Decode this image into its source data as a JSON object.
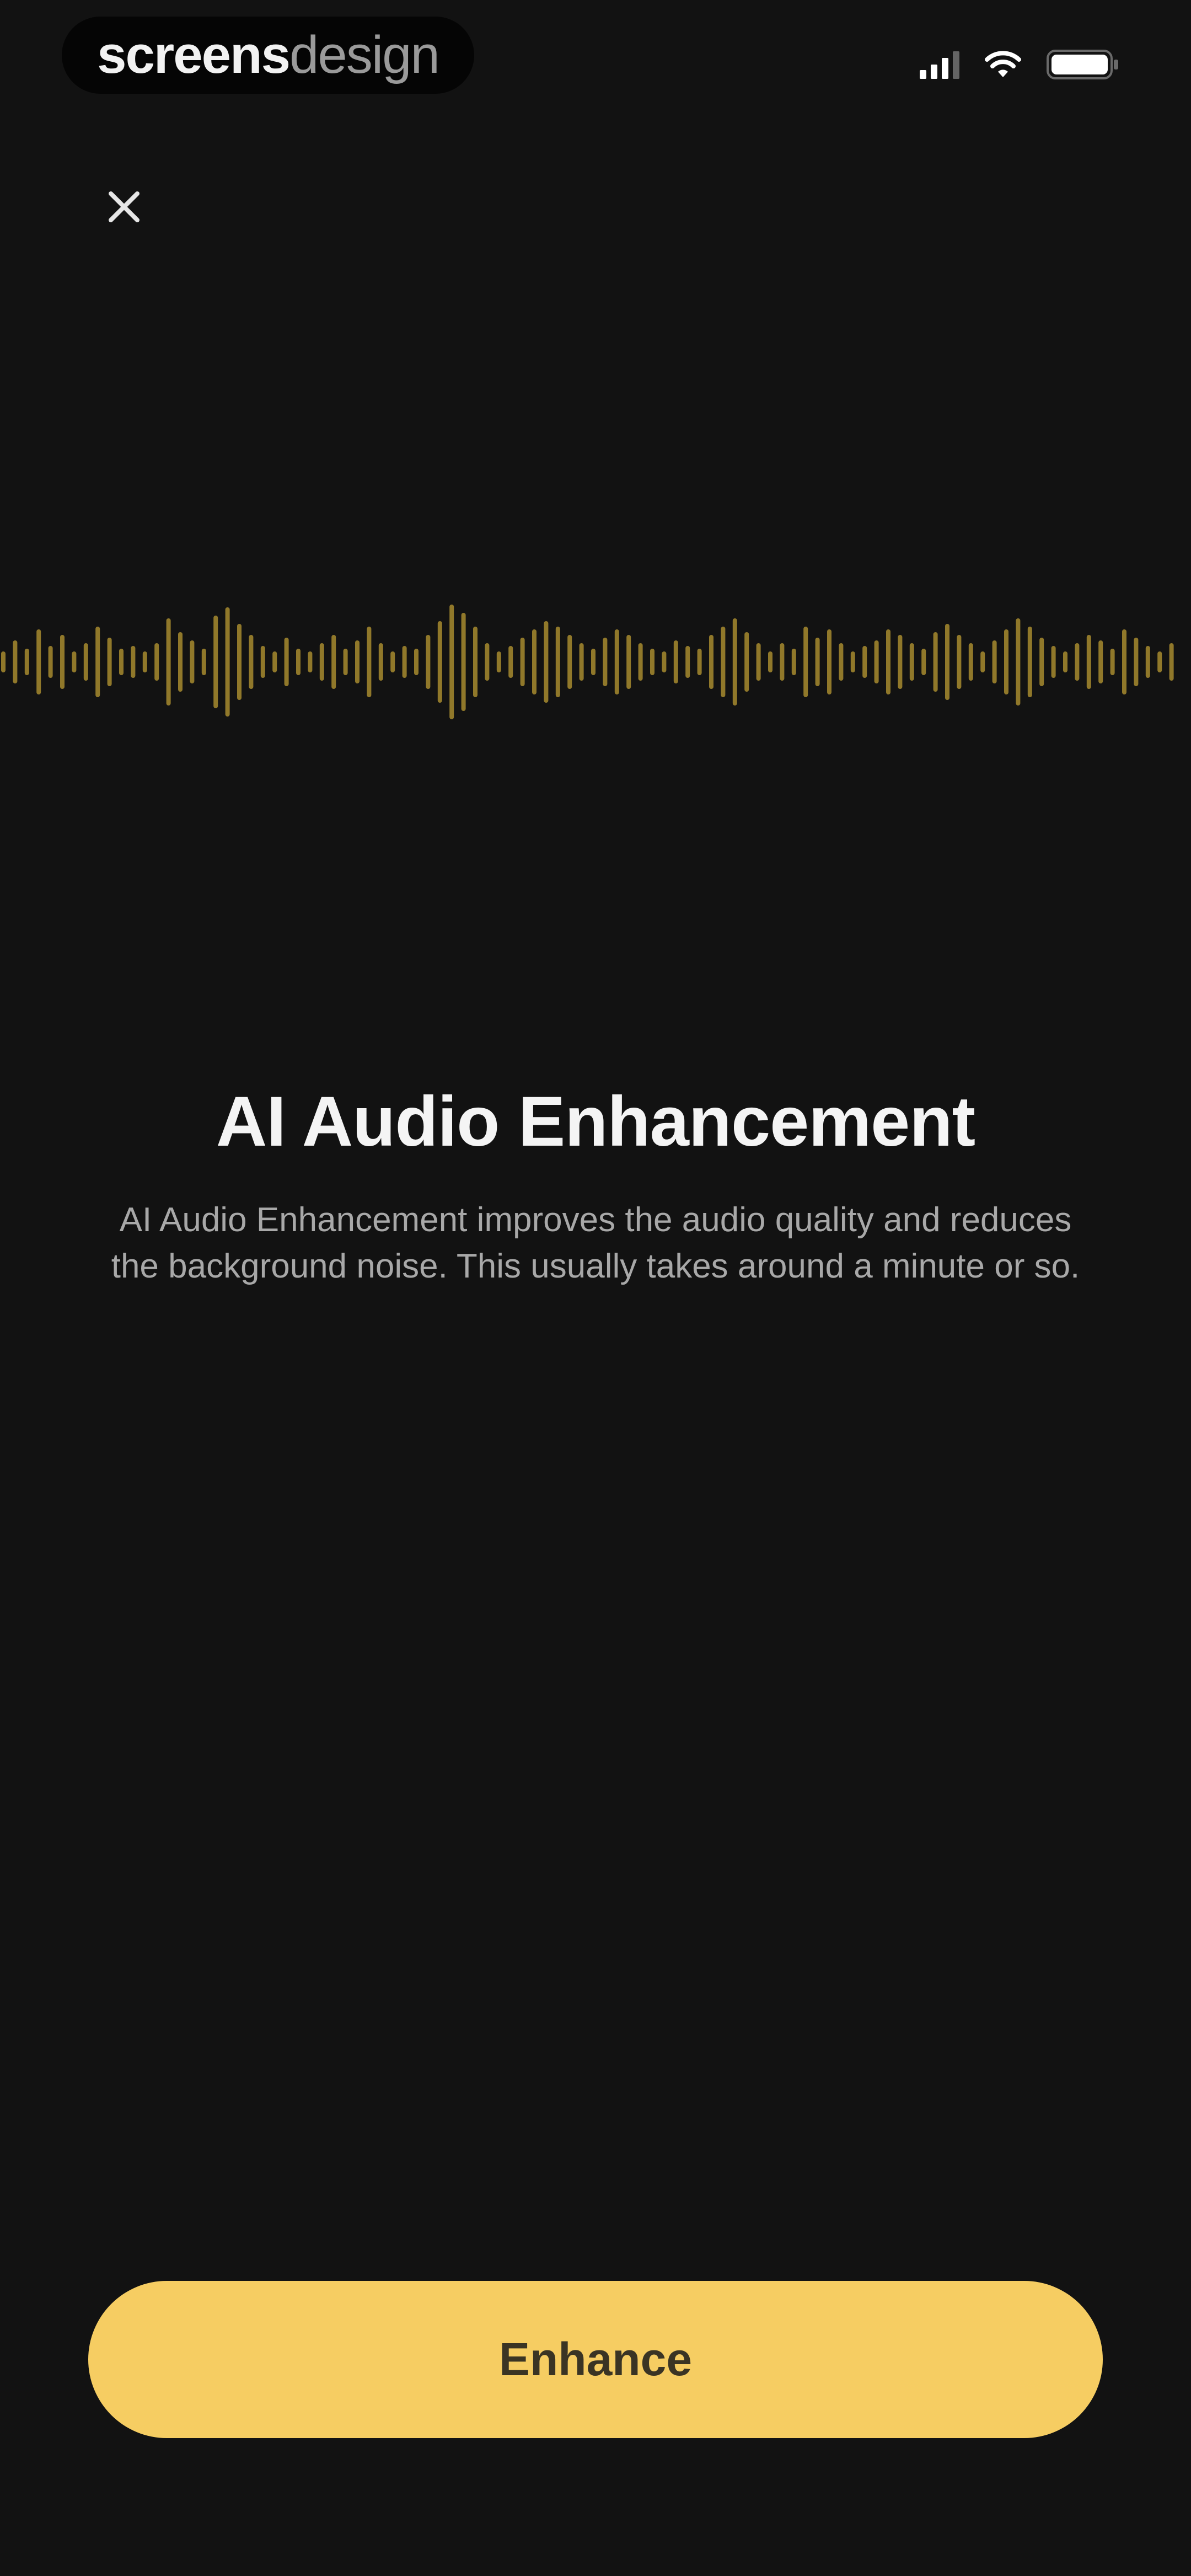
{
  "status_bar": {
    "brand": {
      "part_bold": "screens",
      "part_light": "design"
    },
    "icons": [
      "signal-icon",
      "wifi-icon",
      "battery-icon"
    ]
  },
  "header": {
    "close_icon": "close-icon"
  },
  "waveform": {
    "color": "#a78a2f",
    "icon": "audio-waveform"
  },
  "content": {
    "title": "AI Audio Enhancement",
    "description": "AI Audio Enhancement improves the audio quality and reduces the background noise. This usually takes around a minute or so."
  },
  "footer": {
    "button_label": "Enhance"
  },
  "colors": {
    "background": "#121212",
    "accent": "#f6cd62",
    "button_text": "#3a3424"
  }
}
